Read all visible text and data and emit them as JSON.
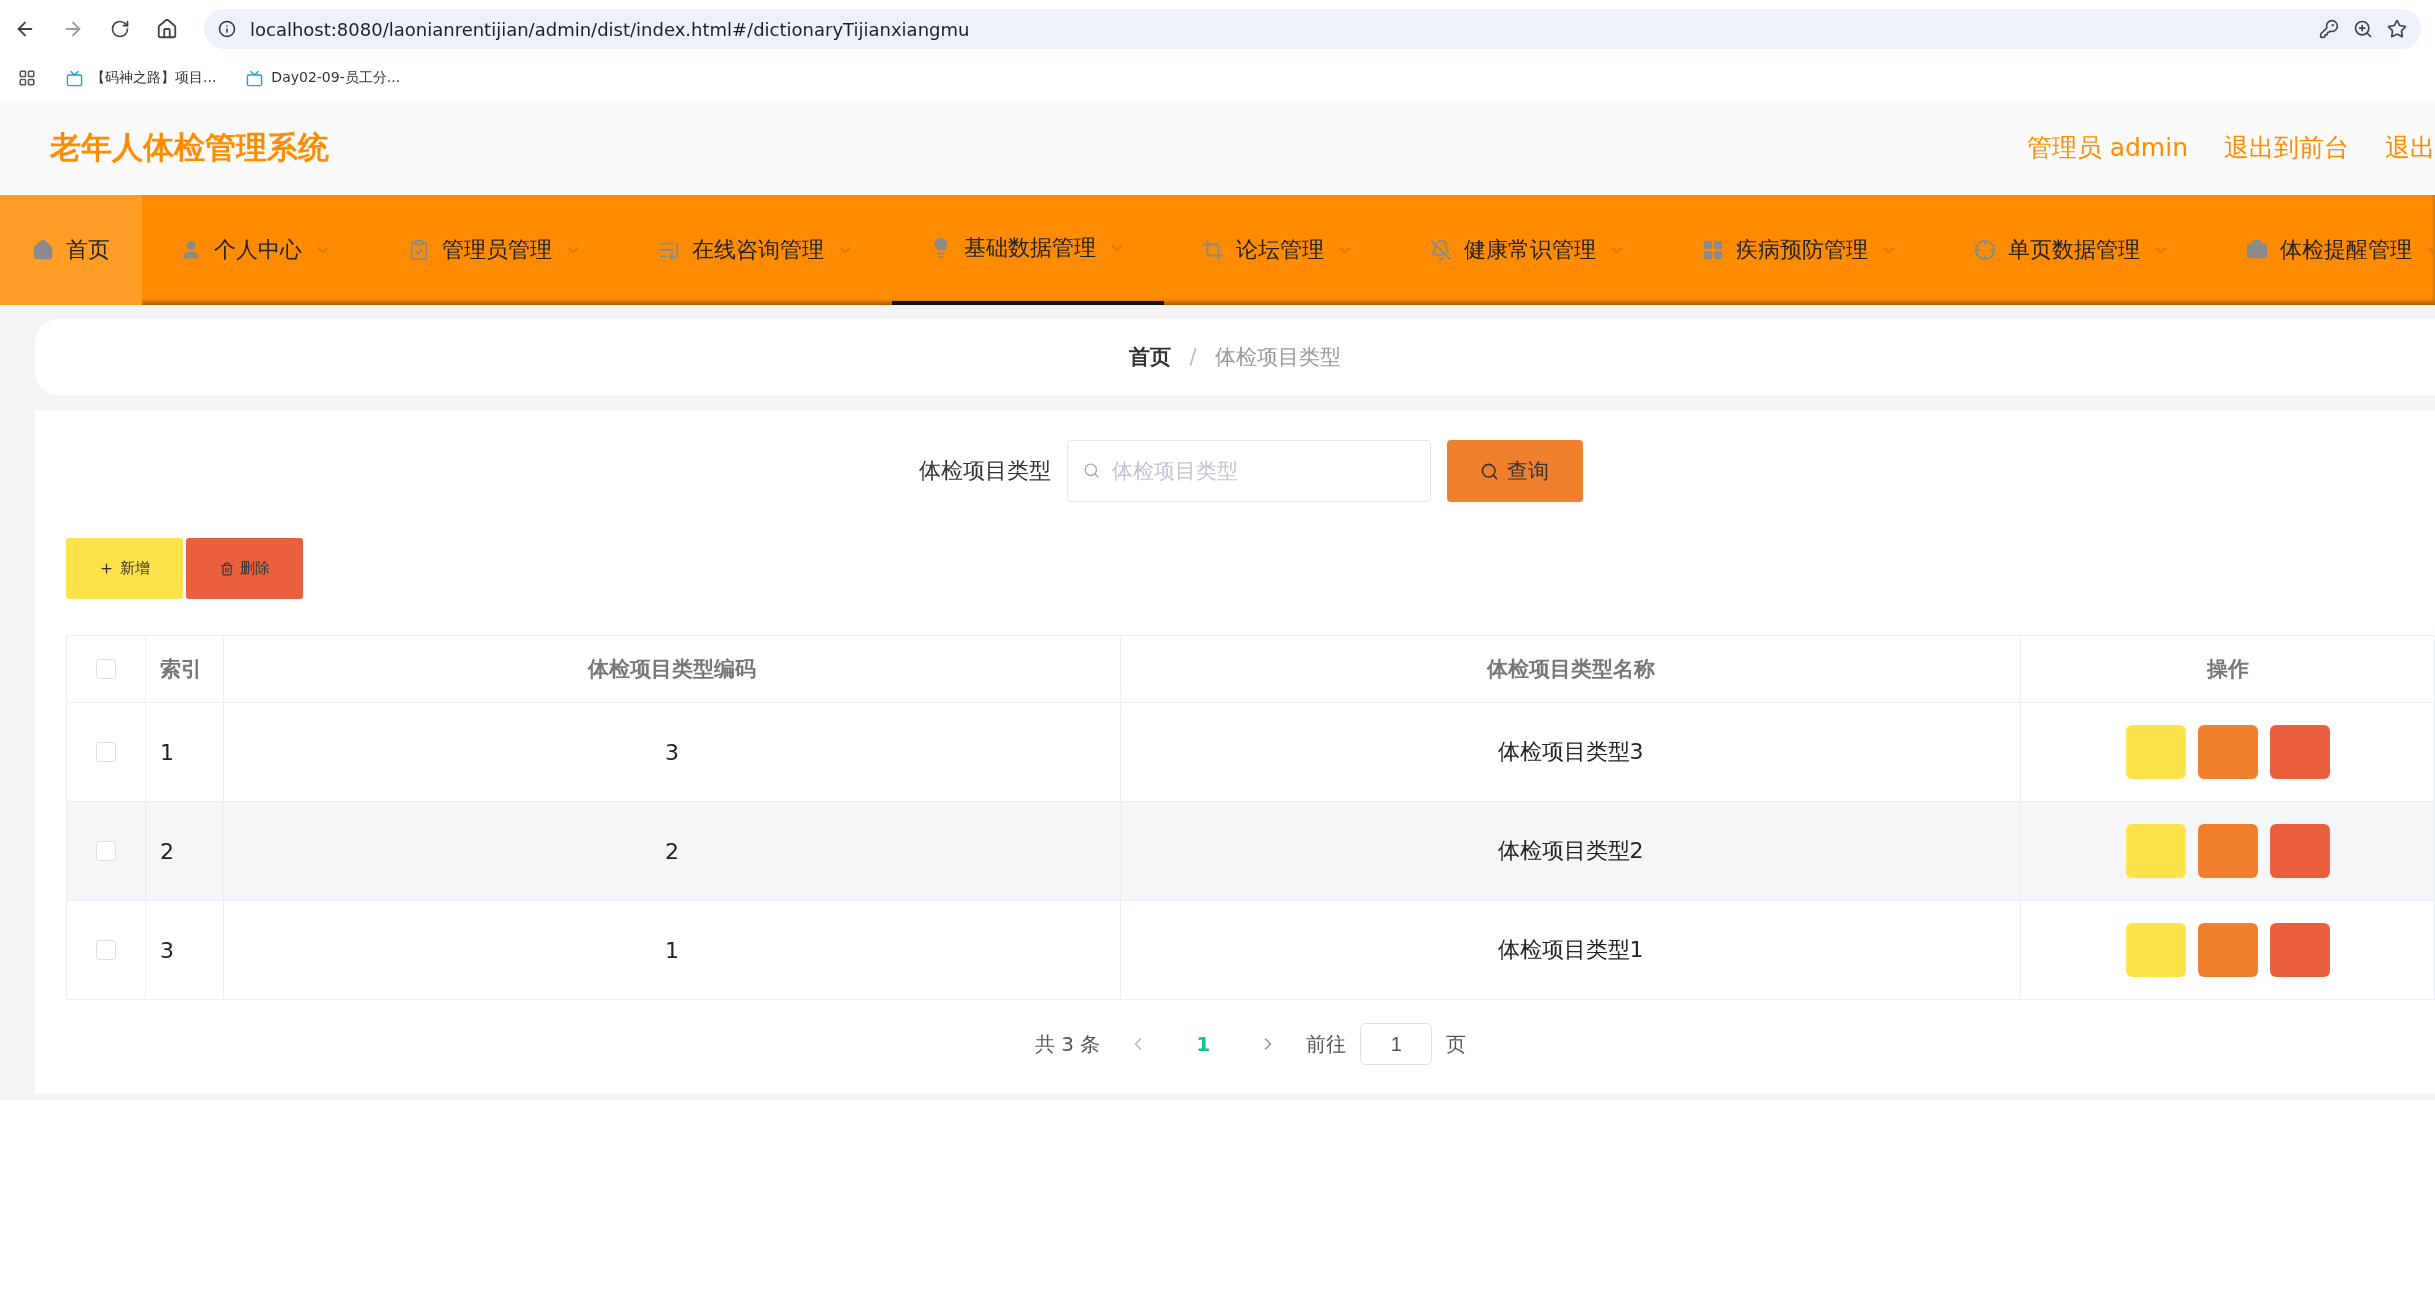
{
  "browser": {
    "url": "localhost:8080/laonianrentijian/admin/dist/index.html#/dictionaryTijianxiangmu",
    "bookmarks": [
      "【码神之路】项目...",
      "Day02-09-员工分..."
    ]
  },
  "header": {
    "title": "老年人体检管理系统",
    "links": [
      "管理员 admin",
      "退出到前台",
      "退出"
    ]
  },
  "nav": [
    {
      "label": "首页",
      "dropdown": false,
      "selected": false,
      "kind": "home"
    },
    {
      "label": "个人中心",
      "dropdown": true,
      "selected": false,
      "kind": "menu"
    },
    {
      "label": "管理员管理",
      "dropdown": true,
      "selected": false,
      "kind": "menu"
    },
    {
      "label": "在线咨询管理",
      "dropdown": true,
      "selected": false,
      "kind": "menu"
    },
    {
      "label": "基础数据管理",
      "dropdown": true,
      "selected": true,
      "kind": "menu"
    },
    {
      "label": "论坛管理",
      "dropdown": true,
      "selected": false,
      "kind": "menu"
    },
    {
      "label": "健康常识管理",
      "dropdown": true,
      "selected": false,
      "kind": "menu"
    },
    {
      "label": "疾病预防管理",
      "dropdown": true,
      "selected": false,
      "kind": "menu"
    },
    {
      "label": "单页数据管理",
      "dropdown": true,
      "selected": false,
      "kind": "menu"
    },
    {
      "label": "体检提醒管理",
      "dropdown": true,
      "selected": false,
      "kind": "menu"
    }
  ],
  "breadcrumb": {
    "items": [
      "首页",
      "体检项目类型"
    ],
    "separator": "/"
  },
  "search": {
    "label": "体检项目类型",
    "placeholder": "体检项目类型",
    "button": "查询"
  },
  "actions": [
    {
      "label": "新增",
      "kind": "add"
    },
    {
      "label": "删除",
      "kind": "delete"
    }
  ],
  "table": {
    "select_all_checked": false,
    "columns": [
      "索引",
      "体检项目类型编码",
      "体检项目类型名称",
      "操作"
    ],
    "rows": [
      {
        "checked": false,
        "cells": [
          "1",
          "3",
          "体检项目类型3"
        ],
        "buttons": [
          {
            "kind": "view"
          },
          {
            "kind": "edit"
          },
          {
            "kind": "delete"
          }
        ]
      },
      {
        "checked": false,
        "cells": [
          "2",
          "2",
          "体检项目类型2"
        ],
        "buttons": [
          {
            "kind": "view"
          },
          {
            "kind": "edit"
          },
          {
            "kind": "delete"
          }
        ]
      },
      {
        "checked": false,
        "cells": [
          "3",
          "1",
          "体检项目类型1"
        ],
        "buttons": [
          {
            "kind": "view"
          },
          {
            "kind": "edit"
          },
          {
            "kind": "delete"
          }
        ]
      }
    ]
  },
  "pagination": {
    "total": "共 3 条",
    "pages": [
      {
        "label": "1",
        "selected": true
      }
    ],
    "goto": "前往",
    "page_value": "1",
    "page_suffix": "页"
  }
}
